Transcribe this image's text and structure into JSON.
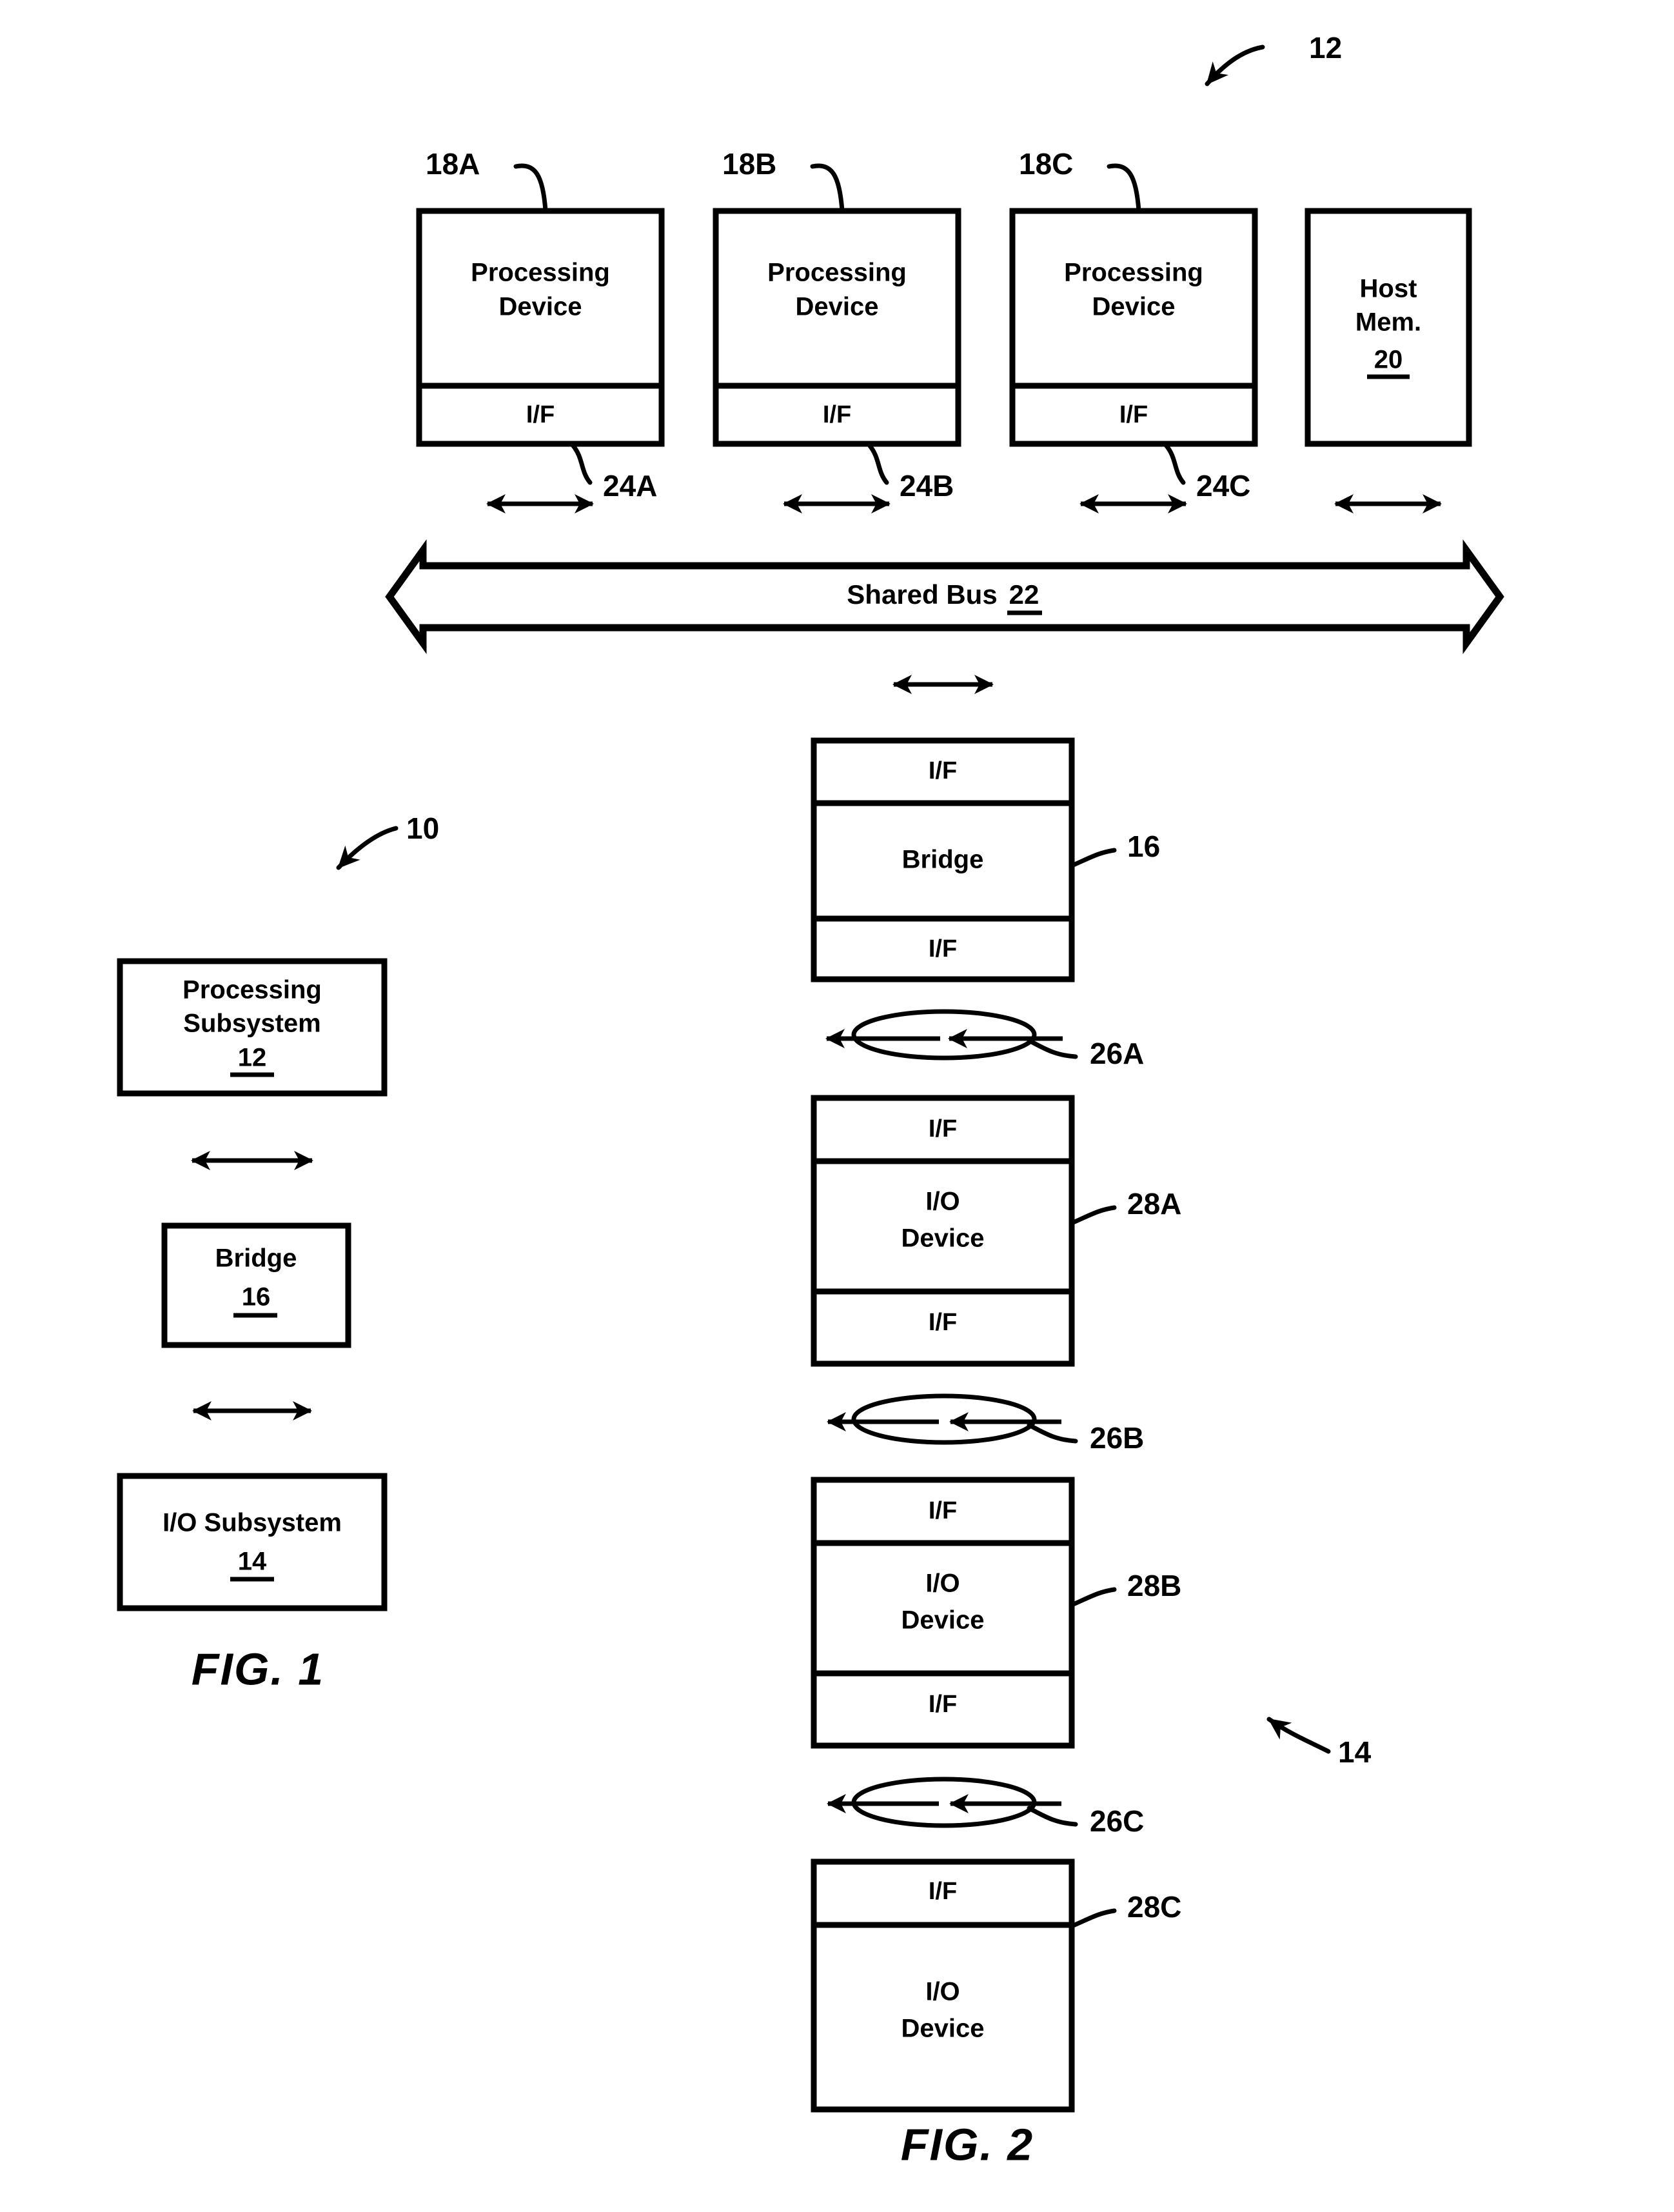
{
  "document": {
    "kind": "patent-drawing-sheet",
    "figures": [
      "FIG. 1",
      "FIG. 2"
    ]
  },
  "fig1": {
    "caption": "FIG. 1",
    "system_ref": "10",
    "blocks": [
      {
        "id": "processing-subsystem",
        "line1": "Processing",
        "line2": "Subsystem",
        "ref": "12"
      },
      {
        "id": "bridge",
        "line1": "Bridge",
        "line2": "",
        "ref": "16"
      },
      {
        "id": "io-subsystem",
        "line1": "I/O Subsystem",
        "line2": "",
        "ref": "14"
      }
    ],
    "connectors": [
      {
        "id": "ps-to-bridge",
        "type": "double-arrow-vertical"
      },
      {
        "id": "bridge-to-io",
        "type": "double-arrow-vertical"
      }
    ]
  },
  "fig2": {
    "caption": "FIG. 2",
    "processing_subsystem_ref": "12",
    "io_subsystem_ref": "14",
    "processing_devices": [
      {
        "ref": "18A",
        "label": "Processing Device",
        "line1": "Processing",
        "line2": "Device",
        "iface": "I/F",
        "link_ref": "24A"
      },
      {
        "ref": "18B",
        "label": "Processing Device",
        "line1": "Processing",
        "line2": "Device",
        "iface": "I/F",
        "link_ref": "24B"
      },
      {
        "ref": "18C",
        "label": "Processing Device",
        "line1": "Processing",
        "line2": "Device",
        "iface": "I/F",
        "link_ref": "24C"
      }
    ],
    "host_memory": {
      "line1": "Host",
      "line2": "Mem.",
      "ref": "20"
    },
    "shared_bus": {
      "label": "Shared Bus",
      "ref": "22"
    },
    "bridge": {
      "iface_top": "I/F",
      "label": "Bridge",
      "iface_bottom": "I/F",
      "ref": "16"
    },
    "links": [
      {
        "ref": "26A",
        "shape": "ellipse-around-pair-of-arrows"
      },
      {
        "ref": "26B",
        "shape": "ellipse-around-pair-of-arrows"
      },
      {
        "ref": "26C",
        "shape": "ellipse-around-pair-of-arrows"
      }
    ],
    "io_devices": [
      {
        "ref": "28A",
        "iface_top": "I/F",
        "line1": "I/O",
        "line2": "Device",
        "iface_bottom": "I/F"
      },
      {
        "ref": "28B",
        "iface_top": "I/F",
        "line1": "I/O",
        "line2": "Device",
        "iface_bottom": "I/F"
      },
      {
        "ref": "28C",
        "iface_top": "I/F",
        "line1": "I/O",
        "line2": "Device",
        "iface_bottom": ""
      }
    ]
  },
  "colors": {
    "ink": "#000000",
    "paper": "#ffffff"
  }
}
